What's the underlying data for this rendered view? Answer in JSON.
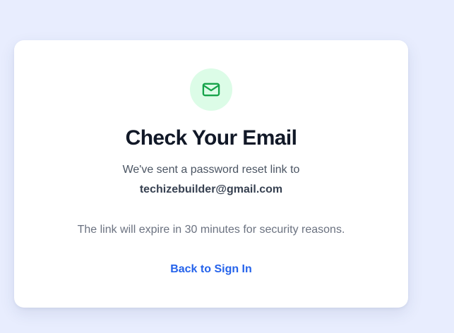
{
  "card": {
    "icon": "mail-icon",
    "title": "Check Your Email",
    "message": "We've sent a password reset link to",
    "email": "techizebuilder@gmail.com",
    "expiry_note": "The link will expire in 30 minutes for security reasons.",
    "back_link": "Back to Sign In"
  },
  "colors": {
    "background": "#e8edfe",
    "icon_bg": "#dcfce7",
    "icon_stroke": "#16a34a",
    "link": "#2563eb",
    "title": "#111827"
  }
}
